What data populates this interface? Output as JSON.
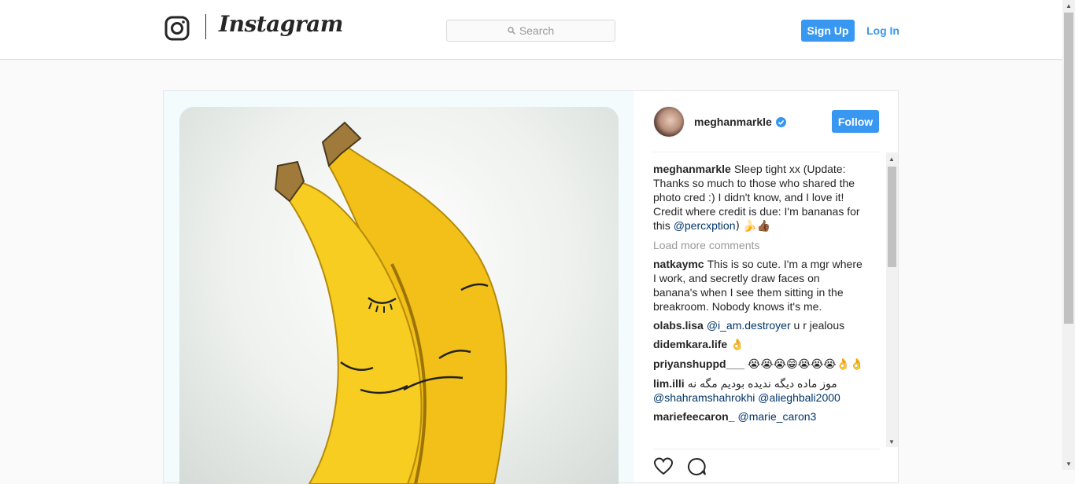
{
  "header": {
    "wordmark": "Instagram",
    "search_placeholder": "Search",
    "signup_label": "Sign Up",
    "login_label": "Log In",
    "accent": "#3897f0"
  },
  "post": {
    "owner": "meghanmarkle",
    "follow_label": "Follow",
    "caption": {
      "user": "meghanmarkle",
      "text_before": "Sleep tight xx (Update: Thanks so much to those who shared the photo cred :) I didn't know, and I love it! Credit where credit is due: I'm bananas for this",
      "mention": "@percxption",
      "text_after": ") 🍌👍🏾"
    },
    "load_more": "Load more comments",
    "comments": [
      {
        "user": "natkaymc",
        "text": "This is so cute. I'm a mgr where I work, and secretly draw faces on banana's when I see them sitting in the breakroom. Nobody knows it's me."
      },
      {
        "user": "olabs.lisa",
        "mention": "@i_am.destroyer",
        "text": "u r jealous"
      },
      {
        "user": "didemkara.life",
        "text": "👌"
      },
      {
        "user": "priyanshuppd___",
        "text": "😭😭😭😁😭😭😭👌👌"
      },
      {
        "user": "lim.illi",
        "text": "موز ماده دیگه ندیده بودیم مگه نه",
        "mention": "@shahramshahrokhi",
        "mention2": "@alieghbali2000"
      },
      {
        "user": "mariefeecaron_",
        "mention": "@marie_caron3"
      }
    ]
  }
}
